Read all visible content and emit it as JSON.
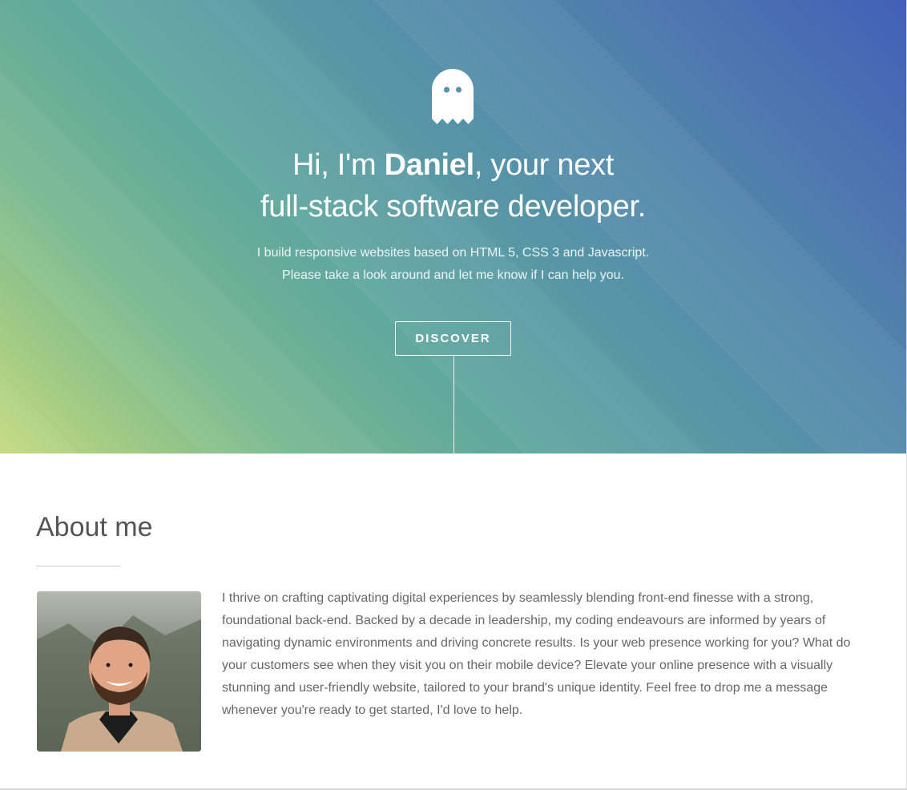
{
  "hero": {
    "title_prefix": "Hi, I'm ",
    "title_name": "Daniel",
    "title_suffix": ", your next",
    "title_line2": "full-stack software developer.",
    "subtitle_line1": "I build responsive websites based on HTML 5, CSS 3 and Javascript.",
    "subtitle_line2": "Please take a look around and let me know if I can help you.",
    "discover_label": "DISCOVER",
    "logo_icon": "ghost-icon"
  },
  "about": {
    "heading": "About me",
    "avatar_alt": "Daniel",
    "body": "I thrive on crafting captivating digital experiences by seamlessly blending front-end finesse with a strong, foundational back-end. Backed by a decade in leadership, my coding endeavours are informed by years of navigating dynamic environments and driving concrete results. Is your web presence working for you? What do your customers see when they visit you on their mobile device? Elevate your online presence with a visually stunning and user-friendly website, tailored to your brand's unique identity. Feel free to drop me a message whenever you're ready to get started, I'd love to help."
  },
  "colors": {
    "gradient_start": "#c3da7e",
    "gradient_mid": "#5ea6a0",
    "gradient_end": "#435fb7",
    "text_white": "#ffffff",
    "heading_gray": "#555555",
    "body_gray": "#666666"
  }
}
